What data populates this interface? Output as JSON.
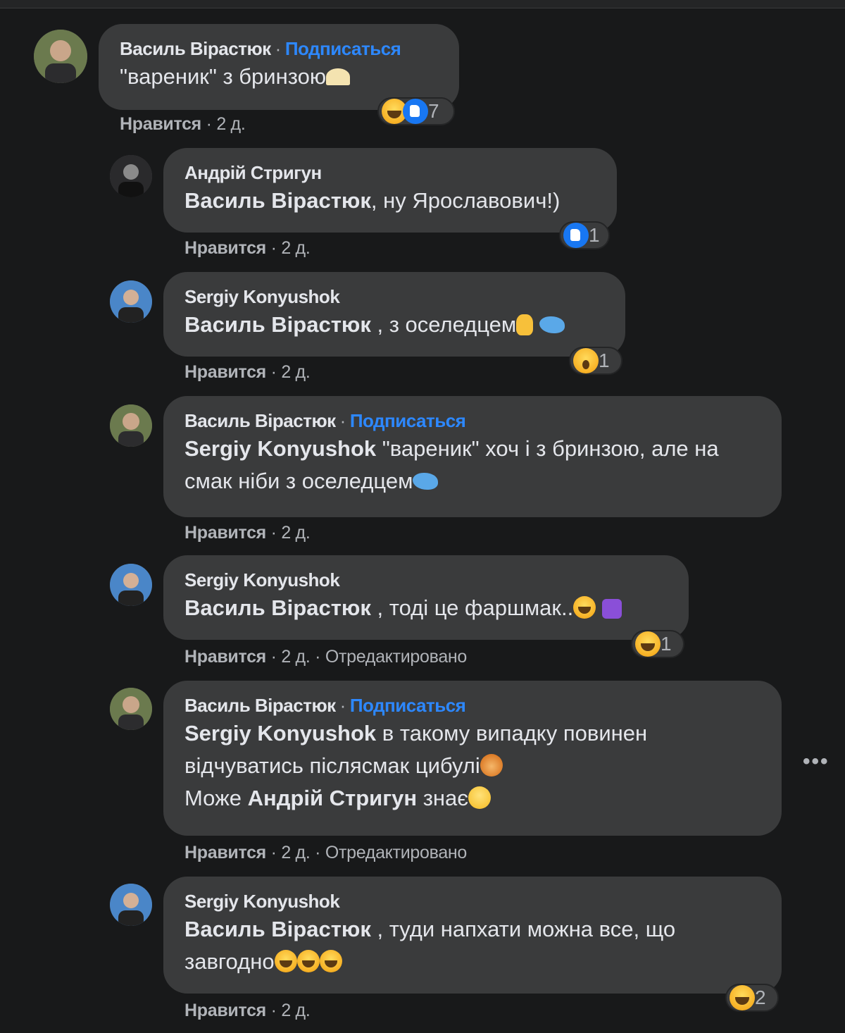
{
  "ui": {
    "follow_label": "Подписаться",
    "like_label": "Нравится",
    "more_label": "•••"
  },
  "comments": [
    {
      "author": "Василь Вірастюк",
      "follow": true,
      "text_plain": "\"вареник\" з бринзою",
      "like": "Нравится",
      "time": "2 д.",
      "edited": "",
      "reactions": [
        "haha",
        "like"
      ],
      "reaction_count": "7"
    },
    {
      "author": "Андрій Стригун",
      "follow": false,
      "mention": "Василь Вірастюк",
      "text_plain": ", ну Ярославович!)",
      "like": "Нравится",
      "time": "2 д.",
      "reactions": [
        "like"
      ],
      "reaction_count": "1"
    },
    {
      "author": "Sergiy Konyushok",
      "follow": false,
      "mention": "Василь Вірастюк",
      "text_plain": " , з оселедцем",
      "like": "Нравится",
      "time": "2 д.",
      "reactions": [
        "wow"
      ],
      "reaction_count": "1"
    },
    {
      "author": "Василь Вірастюк",
      "follow": true,
      "mention": "Sergiy Konyushok",
      "text_plain": " \"вареник\" хоч і з бринзою, але на смак ніби з оселедцем",
      "like": "Нравится",
      "time": "2 д."
    },
    {
      "author": "Sergiy Konyushok",
      "follow": false,
      "mention": "Василь Вірастюк",
      "text_plain": " , тоді це фаршмак..",
      "like": "Нравится",
      "time": "2 д.",
      "edited": "Отредактировано",
      "reactions": [
        "haha"
      ],
      "reaction_count": "1"
    },
    {
      "author": "Василь Вірастюк",
      "follow": true,
      "mention": "Sergiy Konyushok",
      "text_plain": " в такому випадку повинен відчуватись післясмак цибулі",
      "line2_prefix": "Може ",
      "mention2": "Андрій Стригун",
      "line2_suffix": " знає",
      "like": "Нравится",
      "time": "2 д.",
      "edited": "Отредактировано"
    },
    {
      "author": "Sergiy Konyushok",
      "follow": false,
      "mention": "Василь Вірастюк",
      "text_plain": " , туди напхати можна все, що завгодно",
      "like": "Нравится",
      "time": "2 д.",
      "reactions": [
        "haha"
      ],
      "reaction_count": "2"
    }
  ]
}
